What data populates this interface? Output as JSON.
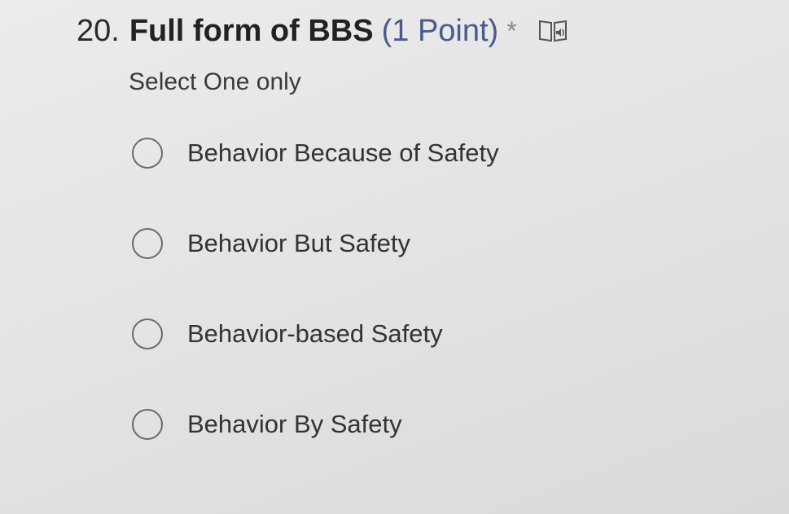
{
  "question": {
    "number": "20.",
    "title": "Full form of BBS",
    "points": "(1 Point)",
    "required_marker": "*",
    "reader_icon": "immersive-reader-icon",
    "subtitle": "Select One only",
    "options": [
      {
        "label": "Behavior Because of Safety"
      },
      {
        "label": "Behavior But Safety"
      },
      {
        "label": "Behavior-based Safety"
      },
      {
        "label": "Behavior By Safety"
      }
    ]
  },
  "colors": {
    "points": "#4a5a8e",
    "required": "#8a8a8a",
    "radio_border": "#6a6a6a"
  }
}
